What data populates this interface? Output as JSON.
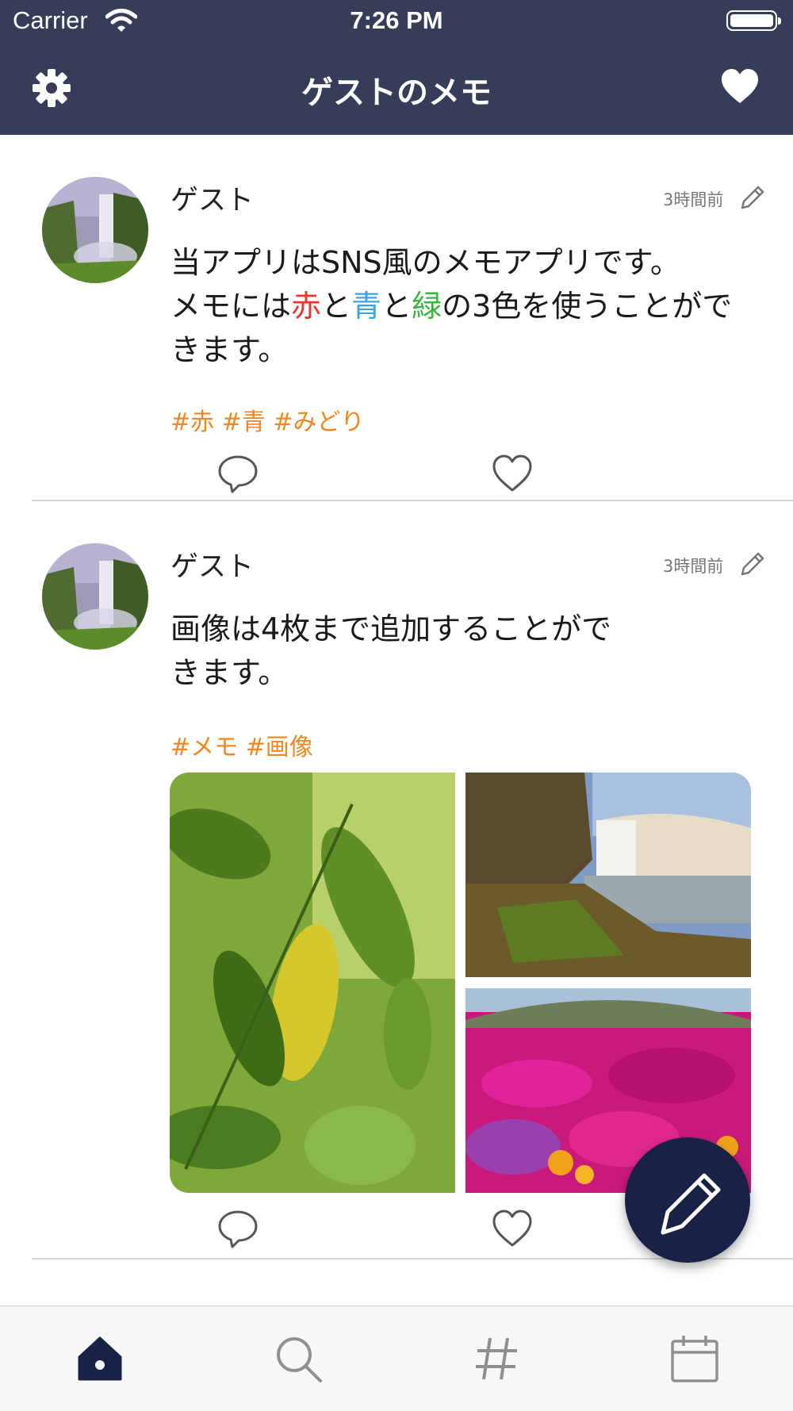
{
  "status_bar": {
    "carrier": "Carrier",
    "time": "7:26 PM"
  },
  "nav": {
    "title": "ゲストのメモ"
  },
  "posts": [
    {
      "author": "ゲスト",
      "time_ago": "3時間前",
      "body_parts": [
        "当アプリはSNS風のメモアプリです。",
        " メモには",
        "赤",
        "と",
        "青",
        "と",
        "緑",
        "の3色を使うことができます。"
      ],
      "tags": "#赤 #青 #みどり"
    },
    {
      "author": "ゲスト",
      "time_ago": "3時間前",
      "body_line1": "画像は4枚まで追加することがで",
      "body_line2": "きます。",
      "tags": "#メモ #画像"
    }
  ],
  "colors": {
    "nav_bg": "#363d59",
    "tag": "#f2861f",
    "red": "#e8372f",
    "blue": "#3aa3e3",
    "green": "#3bb43f",
    "fab": "#192146",
    "tab_active": "#192146",
    "tab_inactive": "#8e8e93"
  },
  "tabs": [
    {
      "icon": "home-icon",
      "active": true
    },
    {
      "icon": "search-icon",
      "active": false
    },
    {
      "icon": "hashtag-icon",
      "active": false
    },
    {
      "icon": "calendar-icon",
      "active": false
    }
  ]
}
